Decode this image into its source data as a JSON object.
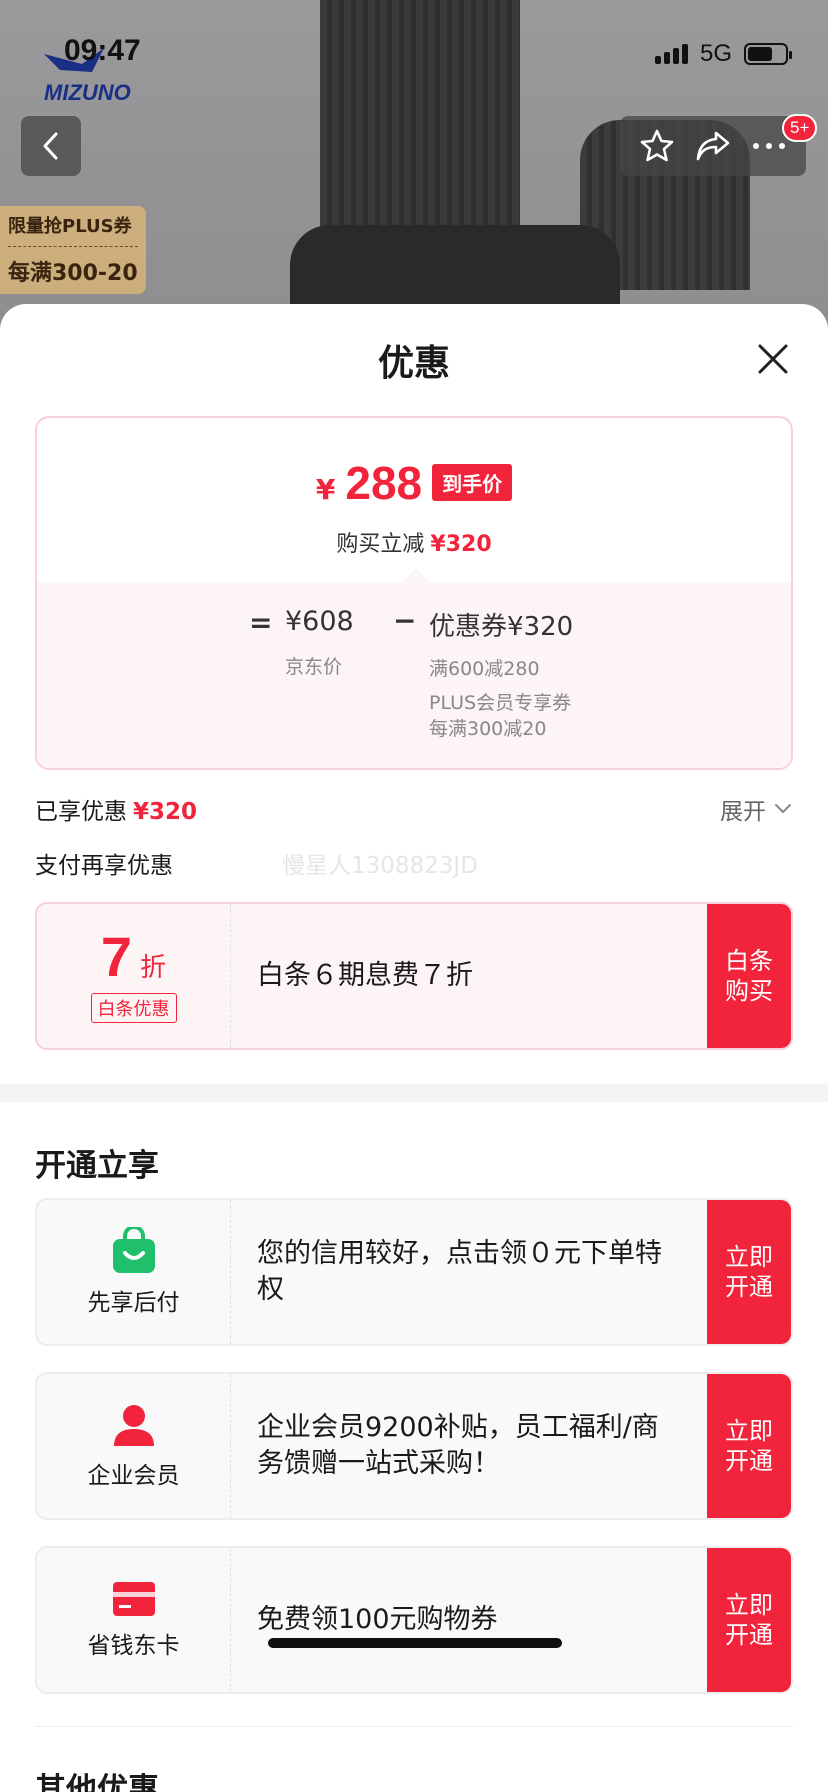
{
  "status_bar": {
    "time": "09:47",
    "network": "5G"
  },
  "brand": {
    "logo_text": "MIZUNO"
  },
  "nav": {
    "cart_badge": "5+"
  },
  "promo_tag": {
    "line1": "限量抢PLUS券",
    "line2": "每满300-20"
  },
  "sheet": {
    "title": "优惠"
  },
  "price_card": {
    "currency": "¥",
    "final_price": "288",
    "final_tag": "到手价",
    "reduce_label": "购买立减",
    "reduce_amount": "¥320",
    "equals": "=",
    "jd_price": "¥608",
    "jd_price_label": "京东价",
    "minus": "−",
    "coupon_total": "优惠券¥320",
    "coupon_1": "满600减280",
    "coupon_2_line1": "PLUS会员专享券",
    "coupon_2_line2": "每满300减20"
  },
  "enjoyed": {
    "label": "已享优惠",
    "amount": "¥320",
    "expand_label": "展开"
  },
  "pay_more": {
    "label": "支付再享优惠",
    "watermark": "慢星人1308823JD"
  },
  "baitiao": {
    "discount_num": "7",
    "discount_unit": "折",
    "tag": "白条优惠",
    "desc": "白条６期息费７折",
    "cta": "白条购买"
  },
  "open_section": {
    "title": "开通立享"
  },
  "offers": [
    {
      "label": "先享后付",
      "icon": "shopping-bag-icon",
      "desc": "您的信用较好，点击领０元下单特权",
      "cta": "立即开通"
    },
    {
      "label": "企业会员",
      "icon": "person-icon",
      "desc": "企业会员9200补贴，员工福利/商务馈赠一站式采购！",
      "cta": "立即开通"
    },
    {
      "label": "省钱东卡",
      "icon": "card-icon",
      "desc": "免费领100元购物券",
      "cta": "立即开通"
    }
  ],
  "other_section": {
    "title": "其他优惠"
  },
  "colors": {
    "accent": "#f2243c",
    "pink_bg": "#fdf4f5",
    "green": "#1fbf6c"
  }
}
